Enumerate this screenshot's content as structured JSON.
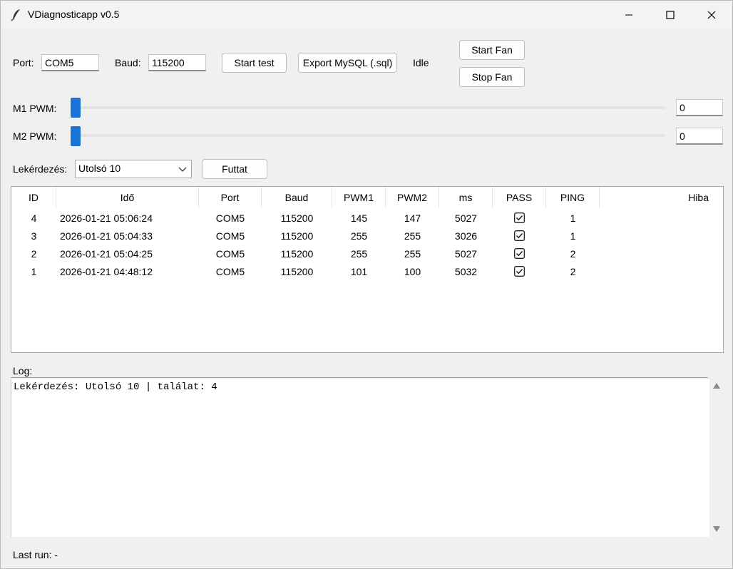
{
  "window": {
    "title": "VDiagnosticapp v0.5"
  },
  "connection": {
    "port_label": "Port:",
    "port_value": "COM5",
    "baud_label": "Baud:",
    "baud_value": "115200",
    "start_test_label": "Start test",
    "export_label": "Export MySQL (.sql)",
    "status_text": "Idle",
    "start_fan_label": "Start Fan",
    "stop_fan_label": "Stop Fan"
  },
  "pwm": {
    "m1_label": "M1 PWM:",
    "m1_value": "0",
    "m2_label": "M2 PWM:",
    "m2_value": "0"
  },
  "query": {
    "label": "Lekérdezés:",
    "selected": "Utolsó 10",
    "run_label": "Futtat"
  },
  "table": {
    "columns": [
      "ID",
      "Idő",
      "Port",
      "Baud",
      "PWM1",
      "PWM2",
      "ms",
      "PASS",
      "PING",
      "Hiba"
    ],
    "rows": [
      {
        "id": "4",
        "time": "2026-01-21 05:06:24",
        "port": "COM5",
        "baud": "115200",
        "pwm1": "145",
        "pwm2": "147",
        "ms": "5027",
        "pass": true,
        "ping": "1",
        "hiba": ""
      },
      {
        "id": "3",
        "time": "2026-01-21 05:04:33",
        "port": "COM5",
        "baud": "115200",
        "pwm1": "255",
        "pwm2": "255",
        "ms": "3026",
        "pass": true,
        "ping": "1",
        "hiba": ""
      },
      {
        "id": "2",
        "time": "2026-01-21 05:04:25",
        "port": "COM5",
        "baud": "115200",
        "pwm1": "255",
        "pwm2": "255",
        "ms": "5027",
        "pass": true,
        "ping": "2",
        "hiba": ""
      },
      {
        "id": "1",
        "time": "2026-01-21 04:48:12",
        "port": "COM5",
        "baud": "115200",
        "pwm1": "101",
        "pwm2": "100",
        "ms": "5032",
        "pass": true,
        "ping": "2",
        "hiba": ""
      }
    ]
  },
  "log": {
    "label": "Log:",
    "text": "Lekérdezés: Utolsó 10 | találat: 4"
  },
  "footer": {
    "last_run": "Last run: -"
  },
  "colors": {
    "accent": "#1a73d9"
  }
}
